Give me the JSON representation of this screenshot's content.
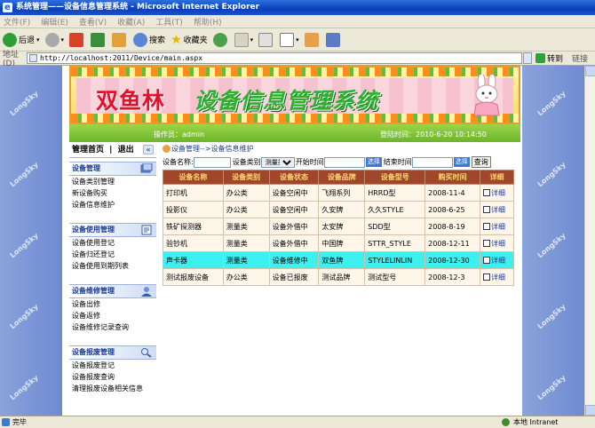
{
  "window": {
    "title": "系统管理——设备信息管理系统 - Microsoft Internet Explorer"
  },
  "menu": [
    "文件(F)",
    "编辑(E)",
    "查看(V)",
    "收藏(A)",
    "工具(T)",
    "帮助(H)"
  ],
  "toolbar": {
    "back": "后退",
    "search": "搜索",
    "favorites": "收藏夹"
  },
  "address": {
    "label": "地址(D)",
    "url": "http://localhost:2011/Device/main.aspx",
    "go": "转到",
    "links": "链接"
  },
  "banner": {
    "title_part1": "双鱼林",
    "title_part2": "设备信息管理系统"
  },
  "info": {
    "operator": "操作员：admin",
    "login_time": "登陆时间：2010-6-20 10:14:50"
  },
  "nav": {
    "home": "管理首页",
    "sep": "|",
    "logout": "退出",
    "collapse": "«",
    "groups": [
      {
        "title": "设备管理",
        "items": [
          "设备类别管理",
          "新设备购买",
          "设备信息维护"
        ]
      },
      {
        "title": "设备使用管理",
        "items": [
          "设备使用登记",
          "设备归还登记",
          "设备使用到期列表"
        ]
      },
      {
        "title": "设备维修管理",
        "items": [
          "设备出修",
          "设备返修",
          "设备维修记录查询"
        ]
      },
      {
        "title": "设备报废管理",
        "items": [
          "设备报废登记",
          "设备报废查询",
          "清理报废设备相关信息"
        ]
      }
    ]
  },
  "main": {
    "breadcrumb": "设备管理-->设备信息维护",
    "search": {
      "name_label": "设备名称:",
      "type_label": "设备类别",
      "type_value": "测量类",
      "start_label": "开始时间",
      "select_btn": "选择",
      "end_label": "结束时间",
      "query": "查询"
    },
    "columns": [
      "设备名称",
      "设备类别",
      "设备状态",
      "设备品牌",
      "设备型号",
      "购买时间",
      "详细"
    ],
    "rows": [
      [
        "打印机",
        "办公类",
        "设备空闲中",
        "飞翔系列",
        "HRRD型",
        "2008-11-4",
        "详细"
      ],
      [
        "投影仪",
        "办公类",
        "设备空闲中",
        "久安牌",
        "久久STYLE",
        "2008-6-25",
        "详细"
      ],
      [
        "铁矿探测器",
        "测量类",
        "设备外借中",
        "太安牌",
        "SDD型",
        "2008-8-19",
        "详细"
      ],
      [
        "验钞机",
        "测量类",
        "设备外借中",
        "中国牌",
        "STTR_STYLE",
        "2008-12-11",
        "详细"
      ],
      [
        "声卡器",
        "测量类",
        "设备维修中",
        "双鱼牌",
        "STYLELINLIN",
        "2008-12-30",
        "详细"
      ],
      [
        "测试报废设备",
        "办公类",
        "设备已报废",
        "测试品牌",
        "测试型号",
        "2008-12-3",
        "详细"
      ]
    ],
    "selected_row": 4
  },
  "watermark": "LongSky",
  "status": {
    "done": "完毕",
    "zone": "本地 Intranet"
  }
}
